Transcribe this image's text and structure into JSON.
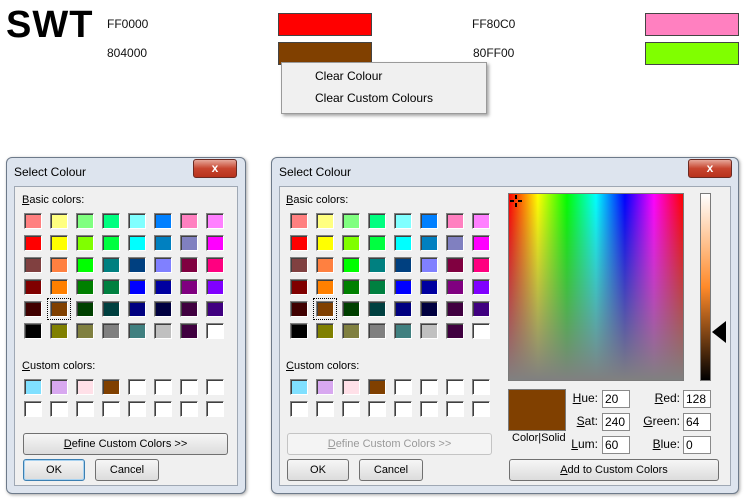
{
  "app": {
    "logo": "SWT"
  },
  "colors_row": [
    {
      "hex": "FF0000",
      "color": "#FF0000"
    },
    {
      "hex": "FF80C0",
      "color": "#FF80C0"
    },
    {
      "hex": "804000",
      "color": "#804000"
    },
    {
      "hex": "80FF00",
      "color": "#80FF00"
    }
  ],
  "context_menu": {
    "items": [
      "Clear Colour",
      "Clear Custom Colours"
    ]
  },
  "dialog_small": {
    "title": "Select Colour",
    "close_glyph": "x",
    "basic_label_first": "B",
    "basic_label_rest": "asic colors:",
    "custom_label_first": "C",
    "custom_label_rest": "ustom colors:",
    "define_first": "D",
    "define_rest": "efine Custom Colors >>",
    "ok": "OK",
    "cancel": "Cancel"
  },
  "dialog_large": {
    "title": "Select Colour",
    "close_glyph": "x",
    "basic_label_first": "B",
    "basic_label_rest": "asic colors:",
    "custom_label_first": "C",
    "custom_label_rest": "ustom colors:",
    "define_first": "D",
    "define_rest": "efine Custom Colors >>",
    "ok": "OK",
    "cancel": "Cancel",
    "colorsolid": "Color|Solid",
    "hue_label": "Hue:",
    "hue": "20",
    "sat_label": "Sat:",
    "sat": "240",
    "lum_label": "Lum:",
    "lum": "60",
    "red_label": "Red:",
    "red": "128",
    "green_label": "Green:",
    "green": "64",
    "blue_label": "Blue:",
    "blue": "0",
    "add_custom": "Add to Custom Colors",
    "selected_color": "#804000"
  },
  "basic_colors": [
    "#FF8080",
    "#FFFF80",
    "#80FF80",
    "#00FF80",
    "#80FFFF",
    "#0080FF",
    "#FF80C0",
    "#FF80FF",
    "#FF0000",
    "#FFFF00",
    "#80FF00",
    "#00FF40",
    "#00FFFF",
    "#0080C0",
    "#8080C0",
    "#FF00FF",
    "#804040",
    "#FF8040",
    "#00FF00",
    "#008080",
    "#004080",
    "#8080FF",
    "#800040",
    "#FF0080",
    "#800000",
    "#FF8000",
    "#008000",
    "#008040",
    "#0000FF",
    "#0000A0",
    "#800080",
    "#8000FF",
    "#400000",
    "#804000",
    "#004000",
    "#004040",
    "#000080",
    "#000040",
    "#400040",
    "#400080",
    "#000000",
    "#808000",
    "#808040",
    "#808080",
    "#408080",
    "#C0C0C0",
    "#400040",
    "#FFFFFF"
  ],
  "custom_colors": [
    "#80E0FF",
    "#D8A8F0",
    "#FFE0E8",
    "#804000",
    "#FFFFFF",
    "#FFFFFF",
    "#FFFFFF",
    "#FFFFFF",
    "#FFFFFF",
    "#FFFFFF",
    "#FFFFFF",
    "#FFFFFF",
    "#FFFFFF",
    "#FFFFFF",
    "#FFFFFF",
    "#FFFFFF"
  ],
  "selected_basic_index": 33
}
